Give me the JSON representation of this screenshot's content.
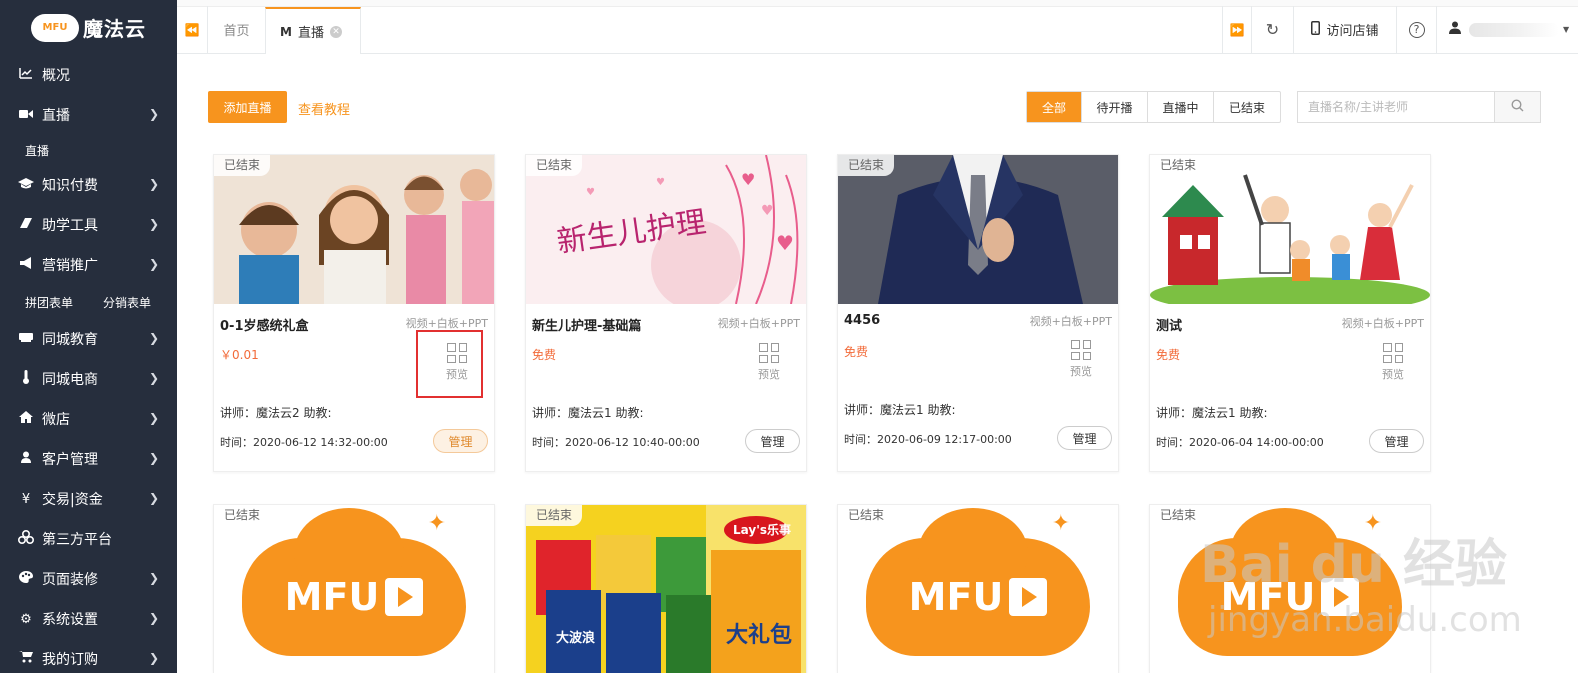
{
  "logo": {
    "badge": "MFU",
    "name": "魔法云"
  },
  "sidebar": {
    "items": [
      {
        "label": "概况",
        "icon": "chart-line-icon",
        "chevron": false
      },
      {
        "label": "直播",
        "icon": "video-camera-icon",
        "chevron": true
      },
      {
        "label": "知识付费",
        "icon": "graduation-cap-icon",
        "chevron": true
      },
      {
        "label": "助学工具",
        "icon": "eraser-icon",
        "chevron": true
      },
      {
        "label": "营销推广",
        "icon": "bullhorn-icon",
        "chevron": true
      },
      {
        "label": "同城教育",
        "icon": "keyboard-icon",
        "chevron": true
      },
      {
        "label": "同城电商",
        "icon": "thermometer-icon",
        "chevron": true
      },
      {
        "label": "微店",
        "icon": "home-icon",
        "chevron": true
      },
      {
        "label": "客户管理",
        "icon": "user-icon",
        "chevron": true
      },
      {
        "label": "交易|资金",
        "icon": "yen-icon",
        "chevron": true
      },
      {
        "label": "第三方平台",
        "icon": "cubes-icon",
        "chevron": false
      },
      {
        "label": "页面装修",
        "icon": "palette-icon",
        "chevron": true
      },
      {
        "label": "系统设置",
        "icon": "gear-icon",
        "chevron": true
      },
      {
        "label": "我的订购",
        "icon": "cart-icon",
        "chevron": true
      }
    ],
    "sub_live": "直播",
    "sub_marketing": [
      "拼团表单",
      "分销表单"
    ]
  },
  "topbar": {
    "tab_home": "首页",
    "tab_live": "直播",
    "visit_store": "访问店铺",
    "help": "?"
  },
  "toolbar": {
    "add_label": "添加直播",
    "tutorial_label": "查看教程",
    "filters": [
      "全部",
      "待开播",
      "直播中",
      "已结束"
    ],
    "search_placeholder": "直播名称/主讲老师"
  },
  "cards": [
    {
      "status": "已结束",
      "title": "0-1岁感统礼盒",
      "type": "视频+白板+PPT",
      "price": "￥0.01",
      "preview": "预览",
      "teacher": "讲师：魔法云2 助教:",
      "time": "时间：2020-06-12 14:32-00:00",
      "manage": "管理"
    },
    {
      "status": "已结束",
      "title": "新生儿护理-基础篇",
      "type": "视频+白板+PPT",
      "price": "免费",
      "preview": "预览",
      "teacher": "讲师：魔法云1 助教:",
      "time": "时间：2020-06-12 10:40-00:00",
      "manage": "管理",
      "thumb_text": "新生儿护理"
    },
    {
      "status": "已结束",
      "title": "4456",
      "type": "视频+白板+PPT",
      "price": "免费",
      "preview": "预览",
      "teacher": "讲师：魔法云1 助教:",
      "time": "时间：2020-06-09 12:17-00:00",
      "manage": "管理"
    },
    {
      "status": "已结束",
      "title": "测试",
      "type": "视频+白板+PPT",
      "price": "免费",
      "preview": "预览",
      "teacher": "讲师：魔法云1 助教:",
      "time": "时间：2020-06-04 14:00-00:00",
      "manage": "管理"
    }
  ],
  "cards_row2": [
    {
      "status": "已结束",
      "logo": "MFU"
    },
    {
      "status": "已结束",
      "brand": "Lay's乐事",
      "brand_sub": "大礼包",
      "bag_text": "大波浪"
    },
    {
      "status": "已结束",
      "logo": "MFU"
    },
    {
      "status": "已结束",
      "logo": "MFU"
    }
  ],
  "watermark": {
    "line1": "Bai du 经验",
    "line2": "jingyan.baidu.com"
  },
  "colors": {
    "accent": "#f7941e",
    "sidebar_bg": "#262e3d",
    "price_red": "#f26b3a",
    "highlight_box": "#e23030"
  }
}
